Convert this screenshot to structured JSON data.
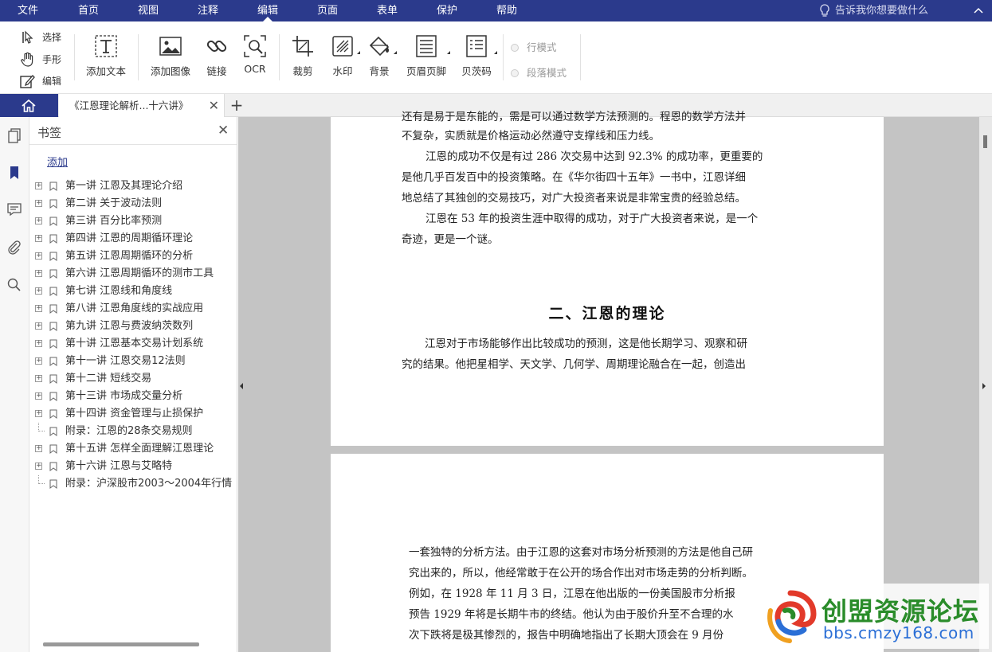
{
  "menubar": {
    "items": [
      "文件",
      "首页",
      "视图",
      "注释",
      "编辑",
      "页面",
      "表单",
      "保护",
      "帮助"
    ],
    "active": "编辑",
    "tell_me": "告诉我你想要做什么"
  },
  "ribbon": {
    "select": "选择",
    "hand": "手形",
    "edit": "编辑",
    "add_text": "添加文本",
    "add_image": "添加图像",
    "link": "链接",
    "ocr": "OCR",
    "crop": "裁剪",
    "watermark": "水印",
    "background": "背景",
    "header_footer": "页眉页脚",
    "bates": "贝茨码",
    "line_mode": "行模式",
    "paragraph_mode": "段落模式"
  },
  "tabs": {
    "doc_title": "《江恩理论解析...十六讲》"
  },
  "panel": {
    "title": "书签",
    "add": "添加",
    "bookmarks": [
      {
        "label": "第一讲  江恩及其理论介绍",
        "expandable": true
      },
      {
        "label": "第二讲  关于波动法则",
        "expandable": true
      },
      {
        "label": "第三讲  百分比率预测",
        "expandable": true
      },
      {
        "label": "第四讲  江恩的周期循环理论",
        "expandable": true
      },
      {
        "label": "第五讲  江恩周期循环的分析",
        "expandable": true
      },
      {
        "label": "第六讲  江恩周期循环的测市工具",
        "expandable": true
      },
      {
        "label": "第七讲  江恩线和角度线",
        "expandable": true
      },
      {
        "label": "第八讲  江恩角度线的实战应用",
        "expandable": true
      },
      {
        "label": "第九讲  江恩与费波纳茨数列",
        "expandable": true
      },
      {
        "label": "第十讲  江恩基本交易计划系统",
        "expandable": true
      },
      {
        "label": "第十一讲  江恩交易12法则",
        "expandable": true
      },
      {
        "label": "第十二讲  短线交易",
        "expandable": true
      },
      {
        "label": "第十三讲  市场成交量分析",
        "expandable": true
      },
      {
        "label": "第十四讲  资金管理与止损保护",
        "expandable": true
      },
      {
        "label": "附录：江恩的28条交易规则",
        "expandable": false
      },
      {
        "label": "第十五讲  怎样全面理解江恩理论",
        "expandable": true
      },
      {
        "label": "第十六讲  江恩与艾略特",
        "expandable": true
      },
      {
        "label": "附录：沪深股市2003～2004年行情",
        "expandable": false
      }
    ]
  },
  "page1": {
    "line0": "还有是易于是东能的，需是可以通过数学方法预测的。程恩的数学方法并",
    "line1": "不复杂，实质就是价格运动必然遵守支撑线和压力线。",
    "line2": "江恩的成功不仅是有过 286 次交易中达到 92.3% 的成功率，更重要的",
    "line3": "是他几乎百发百中的投资策略。在《华尔街四十五年》一书中，江恩详细",
    "line4": "地总结了其独创的交易技巧，对广大投资者来说是非常宝贵的经验总结。",
    "line5": "江恩在 53 年的投资生涯中取得的成功，对于广大投资者来说，是一个",
    "line6": "奇迹，更是一个谜。",
    "heading": "二、江恩的理论",
    "line7": "江恩对于市场能够作出比较成功的预测，这是他长期学习、观察和研",
    "line8": "究的结果。他把星相学、天文学、几何学、周期理论融合在一起，创造出"
  },
  "page2": {
    "line1": "一套独特的分析方法。由于江恩的这套对市场分析预测的方法是他自己研",
    "line2": "究出来的，所以，他经常敢于在公开的场合作出对市场走势的分析判断。",
    "line3": "例如，在 1928 年 11 月 3 日，江恩在他出版的一份美国股市分析报",
    "line4": "预告 1929 年将是长期牛市的终结。他认为由于股价升至不合理的水",
    "line5": "次下跌将是极其惨烈的，报告中明确地指出了长期大顶会在 9 月份"
  },
  "watermark": {
    "title": "创盟资源论坛",
    "url": "bbs.cmzy168.com"
  },
  "colors": {
    "menubar": "#2b3a8c",
    "doc_bg": "#c4c4c4",
    "watermark_green": "#2a8c2a",
    "watermark_blue": "#2b6fd6"
  }
}
